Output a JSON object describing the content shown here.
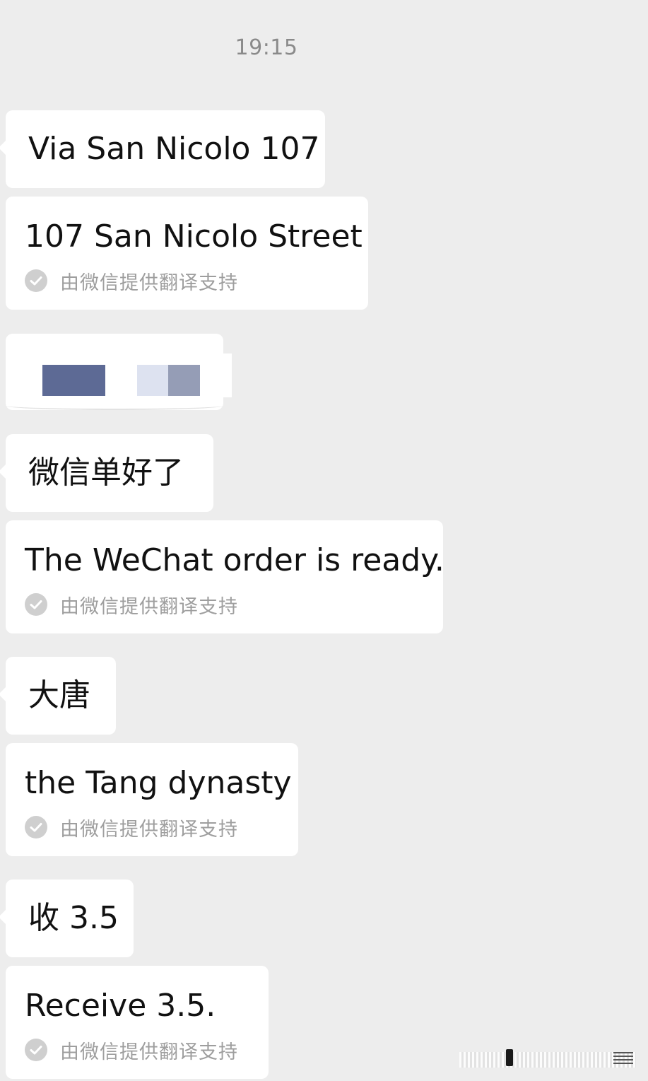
{
  "chat": {
    "timestamp": "19:15",
    "translation_note": "由微信提供翻译支持",
    "messages": [
      {
        "text": "Via San Nicolo 107",
        "translation": "107 San Nicolo Street"
      },
      {
        "text": "微信单好了",
        "translation": "The WeChat order is ready."
      },
      {
        "text": "大唐",
        "translation": "the Tang dynasty"
      },
      {
        "text": "收 3.5",
        "translation": "Receive 3.5."
      }
    ],
    "redacted_colors": [
      "#5d6a95",
      "#dde2f0",
      "#959db6"
    ]
  },
  "icons": {
    "translation_status": "check-circle-icon"
  }
}
